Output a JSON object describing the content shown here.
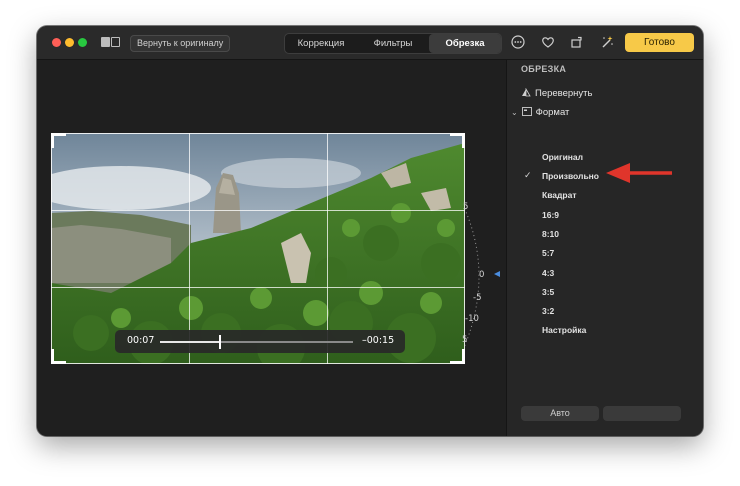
{
  "toolbar": {
    "revert_label": "Вернуть к оригиналу",
    "tabs": [
      {
        "label": "Коррекция",
        "active": false
      },
      {
        "label": "Фильтры",
        "active": false
      },
      {
        "label": "Обрезка",
        "active": true
      }
    ],
    "done_label": "Готово",
    "accent_color": "#f7c948"
  },
  "video": {
    "current_time": "00:07",
    "remaining_time": "–00:15",
    "progress": 0.31
  },
  "dial": {
    "labels": [
      "5",
      "0",
      "-5",
      "-10",
      "5"
    ]
  },
  "sidebar": {
    "title": "ОБРЕЗКА",
    "flip_label": "Перевернуть",
    "format_label": "Формат",
    "formats": [
      {
        "label": "Оригинал",
        "selected": false
      },
      {
        "label": "Произвольно",
        "selected": true
      },
      {
        "label": "Квадрат",
        "selected": false
      },
      {
        "label": "16:9",
        "selected": false
      },
      {
        "label": "8:10",
        "selected": false
      },
      {
        "label": "5:7",
        "selected": false
      },
      {
        "label": "4:3",
        "selected": false
      },
      {
        "label": "3:5",
        "selected": false
      },
      {
        "label": "3:2",
        "selected": false
      },
      {
        "label": "Настройка",
        "selected": false
      }
    ],
    "auto_label": "Авто",
    "checkmark": "✓",
    "annotation_color": "#e0352b"
  }
}
